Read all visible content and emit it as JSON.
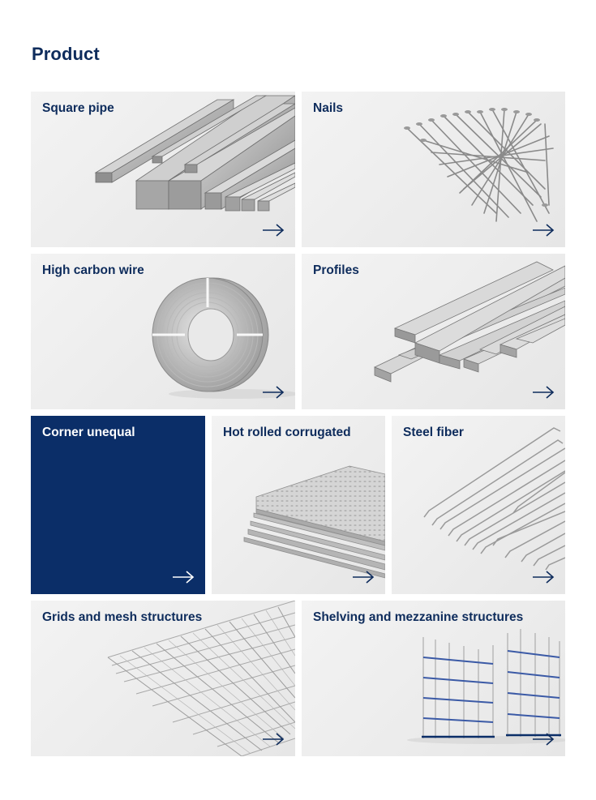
{
  "page": {
    "title": "Product"
  },
  "products": [
    {
      "label": "Square pipe",
      "icon": "arrow-right-icon"
    },
    {
      "label": "Nails",
      "icon": "arrow-right-icon"
    },
    {
      "label": "High carbon wire",
      "icon": "arrow-right-icon"
    },
    {
      "label": "Profiles",
      "icon": "arrow-right-icon"
    },
    {
      "label": "Corner unequal",
      "icon": "arrow-right-icon"
    },
    {
      "label": "Hot rolled corrugated",
      "icon": "arrow-right-icon"
    },
    {
      "label": "Steel fiber",
      "icon": "arrow-right-icon"
    },
    {
      "label": "Grids and mesh structures",
      "icon": "arrow-right-icon"
    },
    {
      "label": "Shelving and mezzanine structures",
      "icon": "arrow-right-icon"
    }
  ],
  "colors": {
    "brand_navy": "#0b2e68",
    "title_navy": "#0e2c5c",
    "card_bg": "#efefef"
  }
}
